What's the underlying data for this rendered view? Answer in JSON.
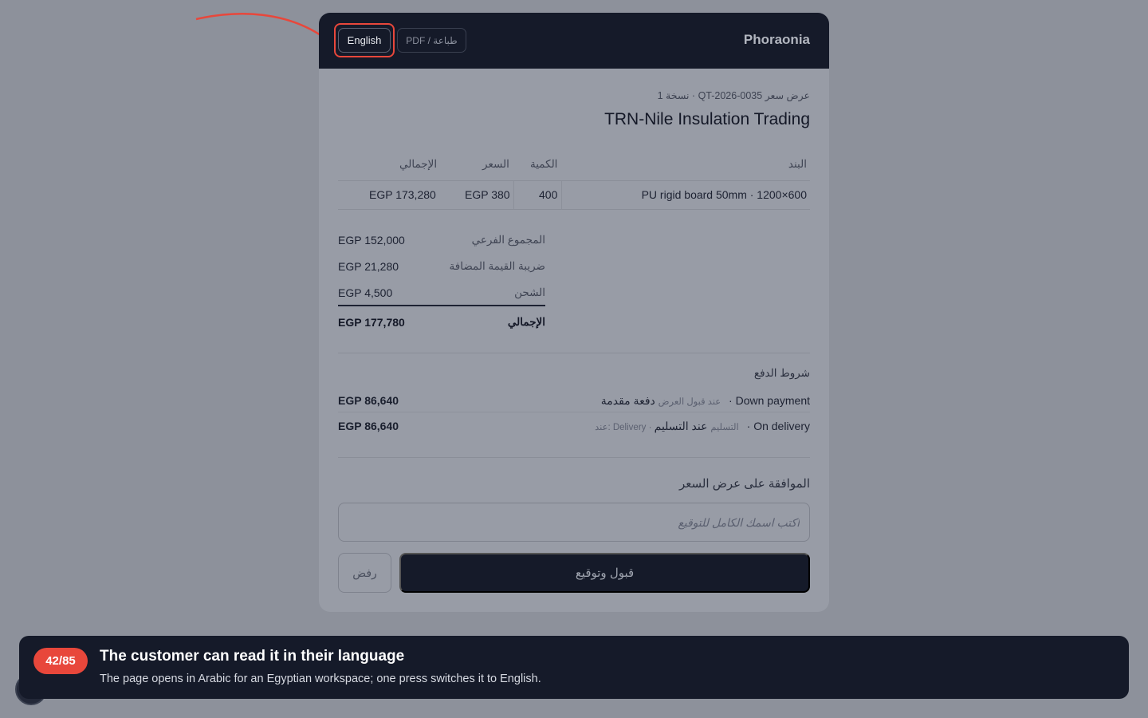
{
  "header": {
    "brand": "Phoraonia",
    "lang_button": "English",
    "print_button": "PDF / طباعة"
  },
  "quote": {
    "meta": "عرض سعر QT-2026-0035 · نسخة 1",
    "customer": "TRN-Nile Insulation Trading"
  },
  "table": {
    "headers": {
      "item": "البند",
      "qty": "الكمية",
      "price": "السعر",
      "total": "الإجمالي"
    },
    "rows": [
      {
        "item": "PU rigid board 50mm · 1200×600",
        "qty": "400",
        "price": "EGP 380",
        "total": "EGP 173,280"
      }
    ]
  },
  "summary": {
    "subtotal_label": "المجموع الفرعي",
    "subtotal": "EGP 152,000",
    "vat_label": "ضريبة القيمة المضافة",
    "vat": "EGP 21,280",
    "shipping_label": "الشحن",
    "shipping": "EGP 4,500",
    "total_label": "الإجمالي",
    "total": "EGP 177,780"
  },
  "payment": {
    "title": "شروط الدفع",
    "terms": [
      {
        "label": "دفعة مقدمة · Down payment",
        "note": "عند قبول العرض",
        "amount": "EGP 86,640"
      },
      {
        "label": "عند التسليم · On delivery",
        "note": "عند: Delivery · التسليم",
        "amount": "EGP 86,640"
      }
    ]
  },
  "acceptance": {
    "title": "الموافقة على عرض السعر",
    "signature_placeholder": "اكتب اسمك الكامل للتوقيع",
    "accept_button": "قبول وتوقيع",
    "reject_button": "رفض"
  },
  "toast": {
    "badge": "42/85",
    "title": "The customer can read it in their language",
    "subtitle": "The page opens in Arabic for an Egyptian workspace; one press switches it to English."
  },
  "colors": {
    "accent": "#e8473b",
    "dark": "#151a29",
    "overlay_bg": "#8d919b"
  }
}
